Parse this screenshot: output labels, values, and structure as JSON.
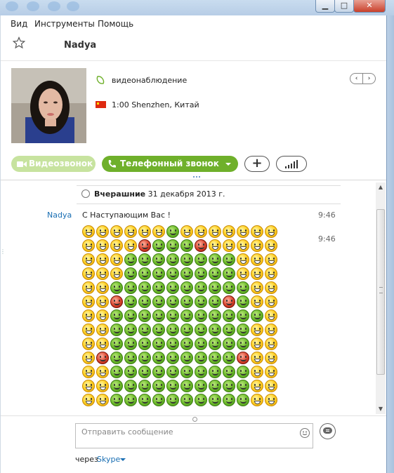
{
  "menubar": {
    "items": [
      "Вид",
      "Инструменты",
      "Помощь"
    ]
  },
  "header": {
    "contact_name": "Nadya"
  },
  "profile": {
    "status_text": "видеонаблюдение",
    "time_location": "1:00 Shenzhen, Китай",
    "nav_prev": "‹",
    "nav_next": "›"
  },
  "actions": {
    "video_call_label": "Видеозвонок",
    "phone_call_label": "Телефонный звонок",
    "add_label": "+"
  },
  "chat": {
    "date_bold": "Вчерашние",
    "date_rest": " 31 декабря 2013 г.",
    "messages": [
      {
        "sender": "Nadya",
        "text": "С Наступающим Вас !",
        "time": "9:46"
      },
      {
        "sender": "",
        "text": "",
        "time": "9:46"
      }
    ],
    "emoji_grid": [
      "yyyyyygyyyyyyy",
      "yyyyrgggryyyyy",
      "yyyggggggggyyy",
      "yyyggggggggyyy",
      "yyggggggggggyy",
      "yyrgggggggrgyy",
      "yygggggggggggy",
      "yyggggggggggyy",
      "yyggggggggggyy",
      "yrgggggggggryy",
      "yyggggggggggyy",
      "yyggggggggggyy",
      "yyggggggggggyy"
    ]
  },
  "compose": {
    "placeholder": "Отправить сообщение",
    "via_label": "через",
    "via_service": "Skype"
  },
  "colors": {
    "accent_green": "#6fb02b",
    "disabled_green": "#c7e39f",
    "link_blue": "#1a6fb3",
    "flag_red": "#de2910"
  },
  "icons": [
    "star-icon",
    "status-icon",
    "flag-icon",
    "clock-icon",
    "phone-icon",
    "video-icon",
    "signal-icon",
    "emoticon-icon",
    "send-icon"
  ]
}
